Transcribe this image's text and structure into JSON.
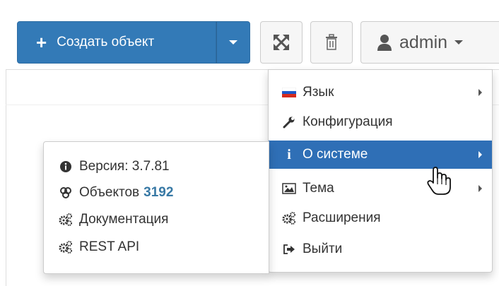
{
  "toolbar": {
    "create_label": "Создать объект",
    "user_label": "admin"
  },
  "user_menu": {
    "items": [
      {
        "label": "Язык",
        "icon": "flag-ru-icon",
        "has_submenu": true
      },
      {
        "label": "Конфигурация",
        "icon": "wrench-icon",
        "has_submenu": false
      },
      {
        "label": "О системе",
        "icon": "info-icon",
        "has_submenu": true,
        "active": true
      },
      {
        "label": "Тема",
        "icon": "image-icon",
        "has_submenu": true
      },
      {
        "label": "Расширения",
        "icon": "cogs-icon",
        "has_submenu": false
      },
      {
        "label": "Выйти",
        "icon": "sign-out-icon",
        "has_submenu": false
      }
    ]
  },
  "about_submenu": {
    "version": "Версия: 3.7.81",
    "objects_label": "Объектов",
    "objects_count": "3192",
    "docs_label": "Документация",
    "api_label": "REST API"
  },
  "colors": {
    "primary": "#337ab7",
    "active_item": "#2f6fb6",
    "count": "#3879a5"
  }
}
